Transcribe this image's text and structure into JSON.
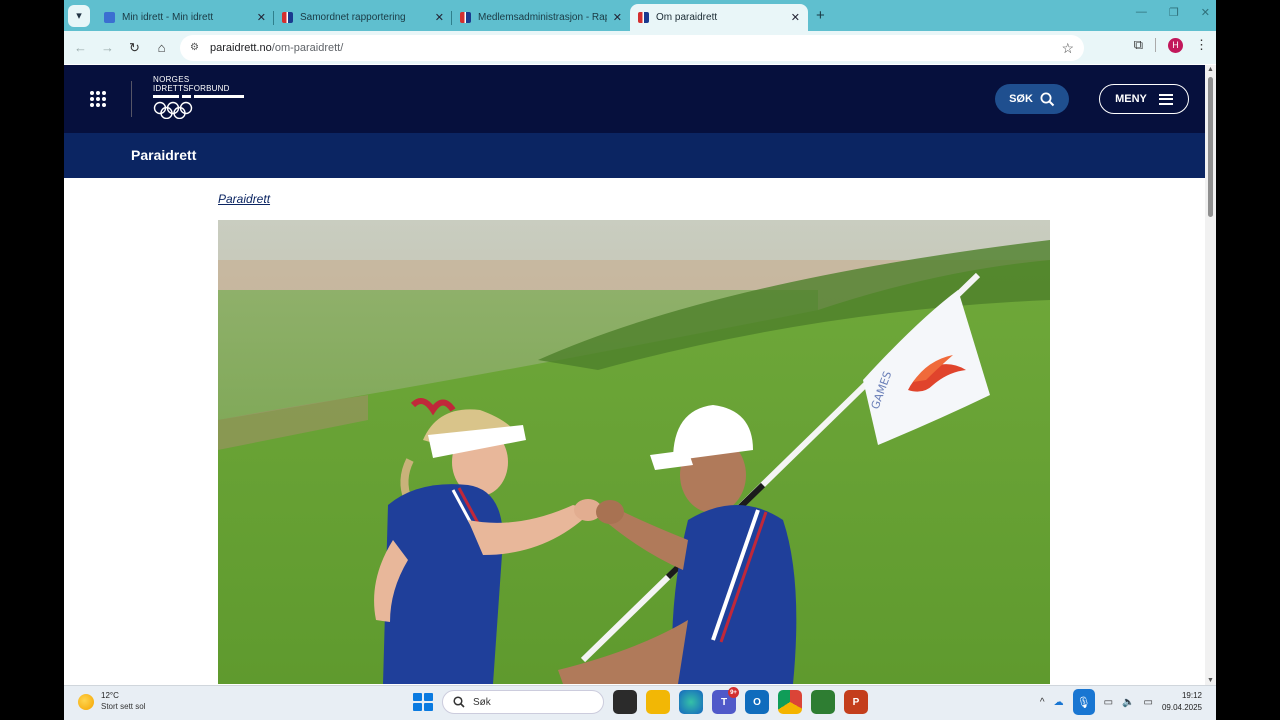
{
  "browser": {
    "tabs": [
      {
        "title": "Min idrett - Min idrett",
        "favicon_color": "#3b6fd1",
        "active": false
      },
      {
        "title": "Samordnet rapportering",
        "favicon_color": "#d32f2f",
        "active": false
      },
      {
        "title": "Medlemsadministrasjon - Rapp",
        "favicon_color": "#d32f2f",
        "active": false
      },
      {
        "title": "Om paraidrett",
        "favicon_color": "#d32f2f",
        "active": true
      }
    ],
    "new_tab_label": "+",
    "url_host": "paraidrett.no",
    "url_path": "/om-paraidrett/",
    "profile_initial": "H"
  },
  "site": {
    "logo_line1": "NORGES",
    "logo_line2": "IDRETTSFORBUND",
    "search_label": "SØK",
    "menu_label": "MENY",
    "section_title": "Paraidrett",
    "breadcrumb": "Paraidrett",
    "accent_color": "#06103d",
    "subbar_color": "#0b2562"
  },
  "taskbar": {
    "temperature": "12°C",
    "weather": "Stort sett sol",
    "search_label": "Søk",
    "teams_badge": "9+",
    "time": "19:12",
    "date": "09.04.2025"
  }
}
